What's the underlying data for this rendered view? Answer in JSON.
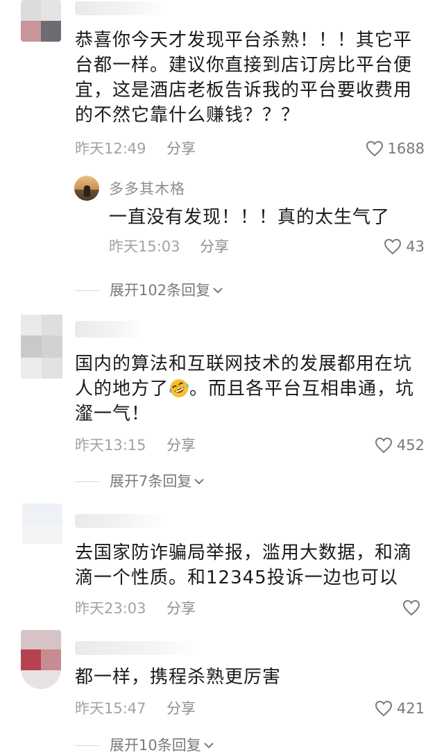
{
  "comments": [
    {
      "text": "恭喜你今天才发现平台杀熟！！！其它平台都一样。建议你直接到店订房比平台便宜，这是酒店老板告诉我的平台要收费用的不然它靠什么赚钱？？？",
      "time": "昨天12:49",
      "share": "分享",
      "likes": "1688",
      "reply": {
        "name": "多多其木格",
        "text": "一直没有发现！！！真的太生气了",
        "time": "昨天15:03",
        "share": "分享",
        "likes": "43"
      },
      "expand": "展开102条回复"
    },
    {
      "text_part1": "国内的算法和互联网技术的发展都用在坑人的地方了",
      "text_part2": "。而且各平台互相串通，坑瀣一气！",
      "emoji": "rolling-on-floor-laughing",
      "time": "昨天13:15",
      "share": "分享",
      "likes": "452",
      "expand": "展开7条回复"
    },
    {
      "text": "去国家防诈骗局举报，滥用大数据，和滴滴一个性质。和12345投诉一边也可以",
      "time": "昨天23:03",
      "share": "分享",
      "likes": ""
    },
    {
      "text": "都一样，携程杀熟更厉害",
      "time": "昨天15:47",
      "share": "分享",
      "likes": "421",
      "expand": "展开10条回复"
    }
  ],
  "icons": {
    "like": "heart-outline-icon",
    "expand": "chevron-down-icon"
  },
  "colors": {
    "text": "#1a1a1a",
    "meta": "#a3a3a3",
    "secondary": "#7a7a7a"
  }
}
